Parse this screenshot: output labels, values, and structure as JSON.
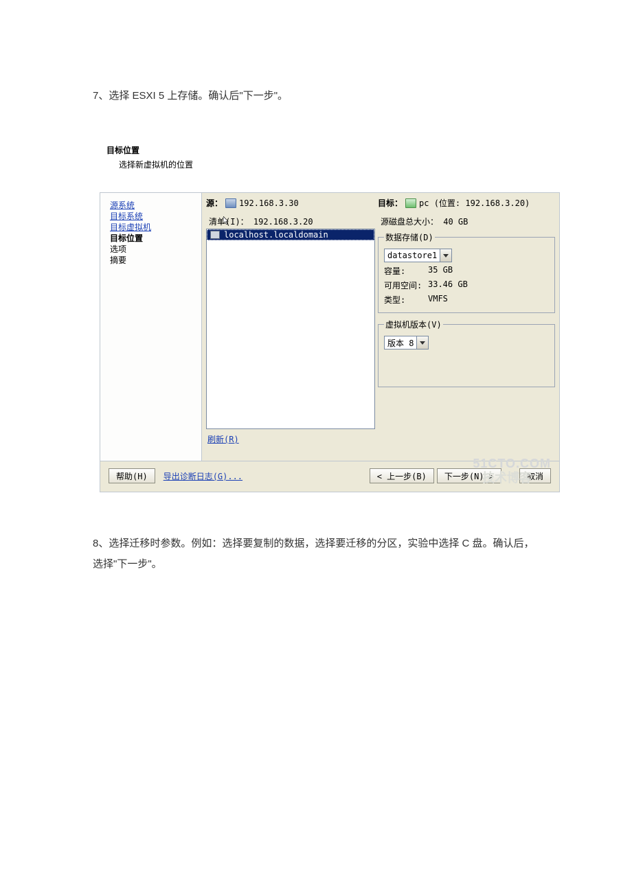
{
  "step7_text": "7、选择 ESXI 5  上存储。确认后\"下一步\"。",
  "step8_text": "8、选择迁移时参数。例如：选择要复制的数据，选择要迁移的分区，实验中选择 C 盘。确认后，选择\"下一步\"。",
  "dialog": {
    "title": "目标位置",
    "subtitle": "选择新虚拟机的位置",
    "nav": {
      "source_system": "源系统",
      "target_system": "目标系统",
      "target_vm": "目标虚拟机",
      "target_location": "目标位置",
      "options": "选项",
      "summary": "摘要"
    },
    "source": {
      "label": "源：",
      "value": "192.168.3.30"
    },
    "target": {
      "label": "目标：",
      "value": "pc (位置: 192.168.3.20)"
    },
    "inventory": {
      "label": "清单(I)：",
      "root": "192.168.3.20",
      "selected": "localhost.localdomain"
    },
    "refresh": "刷新(R)",
    "disk": {
      "total_label": "源磁盘总大小：",
      "total_value": "40 GB"
    },
    "datastore": {
      "legend": "数据存储(D)",
      "selected": "datastore1",
      "capacity_label": "容量:",
      "capacity_value": "35 GB",
      "free_label": "可用空间:",
      "free_value": "33.46 GB",
      "type_label": "类型:",
      "type_value": "VMFS"
    },
    "vmversion": {
      "legend": "虚拟机版本(V)",
      "selected": "版本 8"
    },
    "buttons": {
      "help": "帮助(H)",
      "export_log": "导出诊断日志(G)...",
      "back": "< 上一步(B)",
      "next": "下一步(N) >",
      "cancel": "取消"
    }
  },
  "watermark1": "51CTO.COM",
  "watermark2": "技术博客"
}
